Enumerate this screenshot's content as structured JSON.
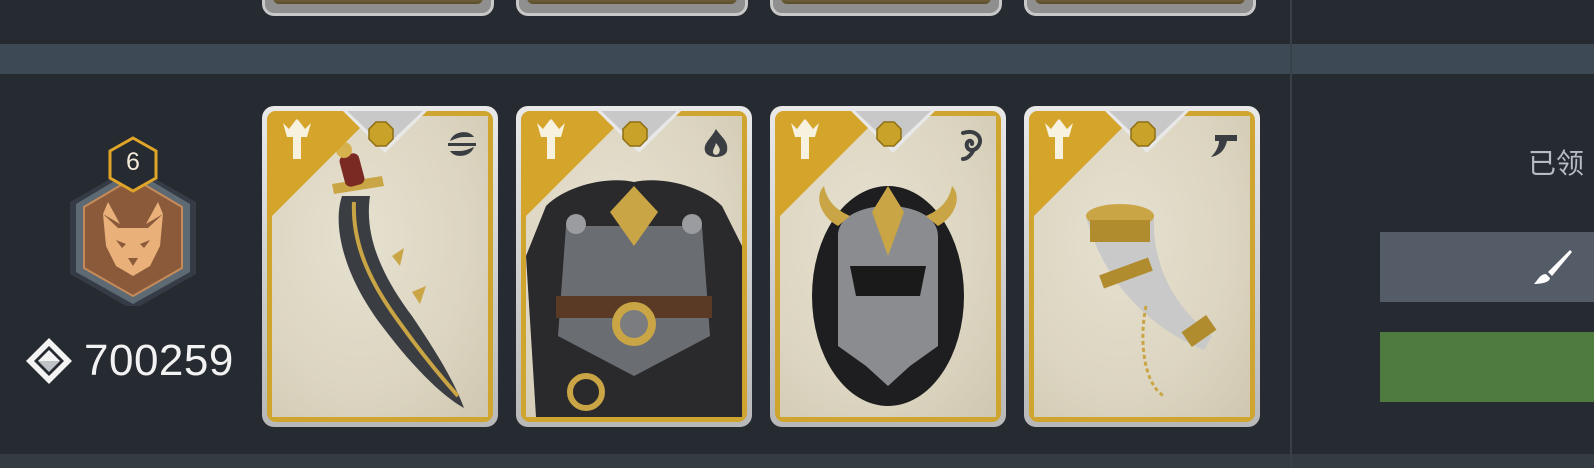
{
  "player": {
    "level": "6",
    "emblem": "wolf-icon",
    "power_icon": "diamond-gem-icon",
    "power": "700259"
  },
  "cards": [
    {
      "name": "dagger",
      "element_icon": "wind-icon",
      "class_icon": "trident-crest-icon",
      "rarity_color": "#d5a42a"
    },
    {
      "name": "chest-armor",
      "element_icon": "fire-icon",
      "class_icon": "trident-crest-icon",
      "rarity_color": "#d5a42a"
    },
    {
      "name": "horned-helmet",
      "element_icon": "spiral-icon",
      "class_icon": "trident-crest-icon",
      "rarity_color": "#d5a42a"
    },
    {
      "name": "drinking-horn",
      "element_icon": "horn-icon",
      "class_icon": "trident-crest-icon",
      "rarity_color": "#d5a42a"
    }
  ],
  "side_panel": {
    "claimed_label": "已领",
    "edit_icon": "brush-icon",
    "gray_button_color": "#545c68",
    "green_button_color": "#4f7b3f"
  }
}
